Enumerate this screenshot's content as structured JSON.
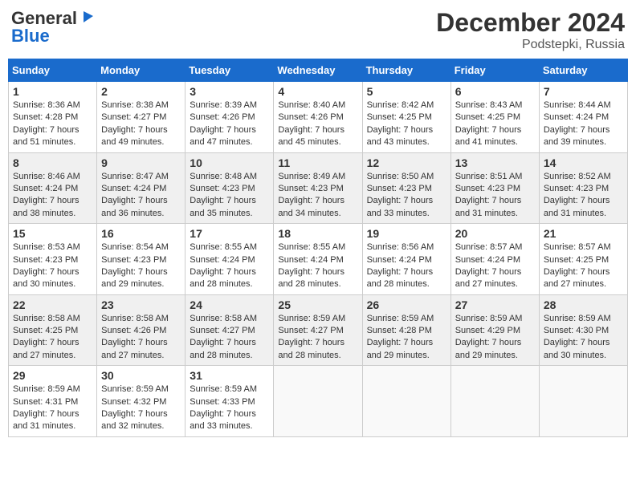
{
  "header": {
    "logo_line1": "General",
    "logo_line2": "Blue",
    "month": "December 2024",
    "location": "Podstepki, Russia"
  },
  "days_of_week": [
    "Sunday",
    "Monday",
    "Tuesday",
    "Wednesday",
    "Thursday",
    "Friday",
    "Saturday"
  ],
  "weeks": [
    [
      {
        "day": "1",
        "sunrise": "8:36 AM",
        "sunset": "4:28 PM",
        "daylight": "7 hours and 51 minutes."
      },
      {
        "day": "2",
        "sunrise": "8:38 AM",
        "sunset": "4:27 PM",
        "daylight": "7 hours and 49 minutes."
      },
      {
        "day": "3",
        "sunrise": "8:39 AM",
        "sunset": "4:26 PM",
        "daylight": "7 hours and 47 minutes."
      },
      {
        "day": "4",
        "sunrise": "8:40 AM",
        "sunset": "4:26 PM",
        "daylight": "7 hours and 45 minutes."
      },
      {
        "day": "5",
        "sunrise": "8:42 AM",
        "sunset": "4:25 PM",
        "daylight": "7 hours and 43 minutes."
      },
      {
        "day": "6",
        "sunrise": "8:43 AM",
        "sunset": "4:25 PM",
        "daylight": "7 hours and 41 minutes."
      },
      {
        "day": "7",
        "sunrise": "8:44 AM",
        "sunset": "4:24 PM",
        "daylight": "7 hours and 39 minutes."
      }
    ],
    [
      {
        "day": "8",
        "sunrise": "8:46 AM",
        "sunset": "4:24 PM",
        "daylight": "7 hours and 38 minutes."
      },
      {
        "day": "9",
        "sunrise": "8:47 AM",
        "sunset": "4:24 PM",
        "daylight": "7 hours and 36 minutes."
      },
      {
        "day": "10",
        "sunrise": "8:48 AM",
        "sunset": "4:23 PM",
        "daylight": "7 hours and 35 minutes."
      },
      {
        "day": "11",
        "sunrise": "8:49 AM",
        "sunset": "4:23 PM",
        "daylight": "7 hours and 34 minutes."
      },
      {
        "day": "12",
        "sunrise": "8:50 AM",
        "sunset": "4:23 PM",
        "daylight": "7 hours and 33 minutes."
      },
      {
        "day": "13",
        "sunrise": "8:51 AM",
        "sunset": "4:23 PM",
        "daylight": "7 hours and 31 minutes."
      },
      {
        "day": "14",
        "sunrise": "8:52 AM",
        "sunset": "4:23 PM",
        "daylight": "7 hours and 31 minutes."
      }
    ],
    [
      {
        "day": "15",
        "sunrise": "8:53 AM",
        "sunset": "4:23 PM",
        "daylight": "7 hours and 30 minutes."
      },
      {
        "day": "16",
        "sunrise": "8:54 AM",
        "sunset": "4:23 PM",
        "daylight": "7 hours and 29 minutes."
      },
      {
        "day": "17",
        "sunrise": "8:55 AM",
        "sunset": "4:24 PM",
        "daylight": "7 hours and 28 minutes."
      },
      {
        "day": "18",
        "sunrise": "8:55 AM",
        "sunset": "4:24 PM",
        "daylight": "7 hours and 28 minutes."
      },
      {
        "day": "19",
        "sunrise": "8:56 AM",
        "sunset": "4:24 PM",
        "daylight": "7 hours and 28 minutes."
      },
      {
        "day": "20",
        "sunrise": "8:57 AM",
        "sunset": "4:24 PM",
        "daylight": "7 hours and 27 minutes."
      },
      {
        "day": "21",
        "sunrise": "8:57 AM",
        "sunset": "4:25 PM",
        "daylight": "7 hours and 27 minutes."
      }
    ],
    [
      {
        "day": "22",
        "sunrise": "8:58 AM",
        "sunset": "4:25 PM",
        "daylight": "7 hours and 27 minutes."
      },
      {
        "day": "23",
        "sunrise": "8:58 AM",
        "sunset": "4:26 PM",
        "daylight": "7 hours and 27 minutes."
      },
      {
        "day": "24",
        "sunrise": "8:58 AM",
        "sunset": "4:27 PM",
        "daylight": "7 hours and 28 minutes."
      },
      {
        "day": "25",
        "sunrise": "8:59 AM",
        "sunset": "4:27 PM",
        "daylight": "7 hours and 28 minutes."
      },
      {
        "day": "26",
        "sunrise": "8:59 AM",
        "sunset": "4:28 PM",
        "daylight": "7 hours and 29 minutes."
      },
      {
        "day": "27",
        "sunrise": "8:59 AM",
        "sunset": "4:29 PM",
        "daylight": "7 hours and 29 minutes."
      },
      {
        "day": "28",
        "sunrise": "8:59 AM",
        "sunset": "4:30 PM",
        "daylight": "7 hours and 30 minutes."
      }
    ],
    [
      {
        "day": "29",
        "sunrise": "8:59 AM",
        "sunset": "4:31 PM",
        "daylight": "7 hours and 31 minutes."
      },
      {
        "day": "30",
        "sunrise": "8:59 AM",
        "sunset": "4:32 PM",
        "daylight": "7 hours and 32 minutes."
      },
      {
        "day": "31",
        "sunrise": "8:59 AM",
        "sunset": "4:33 PM",
        "daylight": "7 hours and 33 minutes."
      },
      null,
      null,
      null,
      null
    ]
  ],
  "labels": {
    "sunrise": "Sunrise:",
    "sunset": "Sunset:",
    "daylight": "Daylight:"
  }
}
